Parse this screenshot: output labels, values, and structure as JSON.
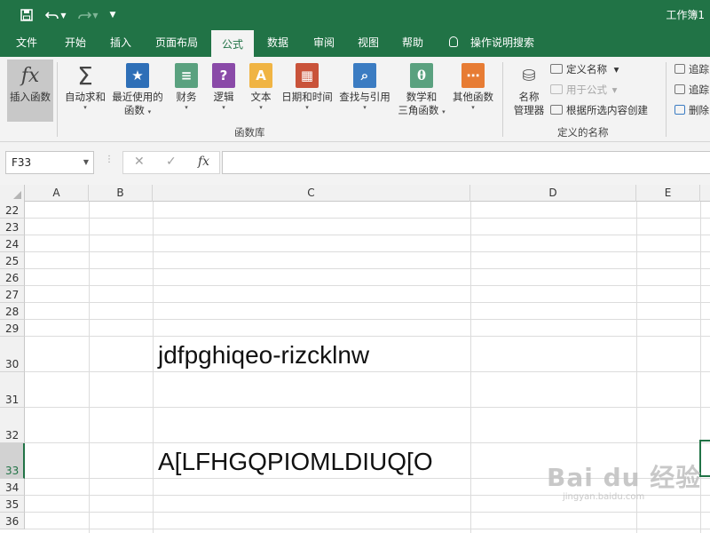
{
  "window": {
    "title": "工作簿1"
  },
  "quick_access": {
    "save_icon": "save-icon",
    "undo_icon": "undo-icon",
    "redo_icon": "redo-icon",
    "customize_icon": "customize-icon"
  },
  "tabs": [
    "文件",
    "开始",
    "插入",
    "页面布局",
    "公式",
    "数据",
    "审阅",
    "视图",
    "帮助"
  ],
  "active_tab": "公式",
  "tell_me": "操作说明搜索",
  "ribbon": {
    "function_library": {
      "group_label": "函数库",
      "insert_function": "插入函数",
      "autosum": "自动求和",
      "recent": [
        "最近使用的",
        "函数"
      ],
      "financial": "财务",
      "logical": "逻辑",
      "text": "文本",
      "datetime": "日期和时间",
      "lookup": "查找与引用",
      "math": [
        "数学和",
        "三角函数"
      ],
      "more": "其他函数"
    },
    "defined_names": {
      "group_label": "定义的名称",
      "name_manager": [
        "名称",
        "管理器"
      ],
      "define_name": "定义名称",
      "use_in_formula": "用于公式",
      "create_from_selection": "根据所选内容创建"
    },
    "formula_auditing": {
      "trace_precedents": "追踪",
      "trace_dependents": "追踪",
      "remove_arrows": "删除"
    }
  },
  "formula_bar": {
    "name_box": "F33",
    "formula": ""
  },
  "grid": {
    "columns": [
      "A",
      "B",
      "C",
      "D",
      "E"
    ],
    "rows": [
      "22",
      "23",
      "24",
      "25",
      "26",
      "27",
      "28",
      "29",
      "30",
      "31",
      "32",
      "33",
      "34",
      "35",
      "36"
    ],
    "active_row": "33",
    "cells": {
      "C30": "jdfpghiqeo-rizcklnw",
      "C33": "A[LFHGQPIOMLDIUQ[O"
    }
  },
  "watermark": {
    "brand": "Bai du 经验",
    "url": "jingyan.baidu.com"
  },
  "colors": {
    "accent": "#217346",
    "ribbon_bg": "#f3f3f3"
  }
}
